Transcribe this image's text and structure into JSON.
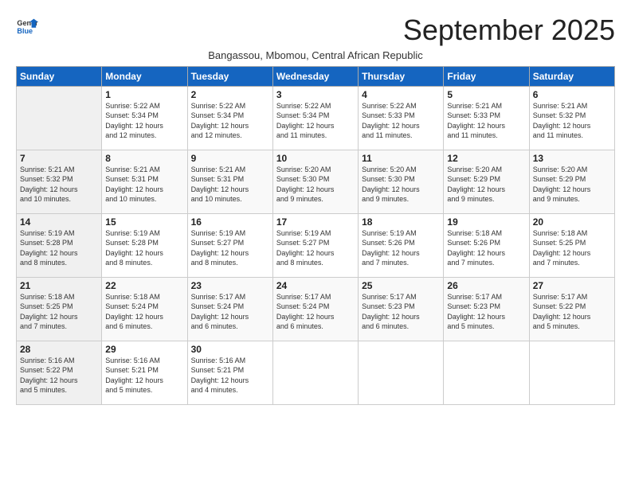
{
  "logo": {
    "line1": "General",
    "line2": "Blue"
  },
  "title": "September 2025",
  "subtitle": "Bangassou, Mbomou, Central African Republic",
  "days_header": [
    "Sunday",
    "Monday",
    "Tuesday",
    "Wednesday",
    "Thursday",
    "Friday",
    "Saturday"
  ],
  "weeks": [
    [
      {
        "day": "",
        "info": ""
      },
      {
        "day": "1",
        "info": "Sunrise: 5:22 AM\nSunset: 5:34 PM\nDaylight: 12 hours\nand 12 minutes."
      },
      {
        "day": "2",
        "info": "Sunrise: 5:22 AM\nSunset: 5:34 PM\nDaylight: 12 hours\nand 12 minutes."
      },
      {
        "day": "3",
        "info": "Sunrise: 5:22 AM\nSunset: 5:34 PM\nDaylight: 12 hours\nand 11 minutes."
      },
      {
        "day": "4",
        "info": "Sunrise: 5:22 AM\nSunset: 5:33 PM\nDaylight: 12 hours\nand 11 minutes."
      },
      {
        "day": "5",
        "info": "Sunrise: 5:21 AM\nSunset: 5:33 PM\nDaylight: 12 hours\nand 11 minutes."
      },
      {
        "day": "6",
        "info": "Sunrise: 5:21 AM\nSunset: 5:32 PM\nDaylight: 12 hours\nand 11 minutes."
      }
    ],
    [
      {
        "day": "7",
        "info": "Sunrise: 5:21 AM\nSunset: 5:32 PM\nDaylight: 12 hours\nand 10 minutes."
      },
      {
        "day": "8",
        "info": "Sunrise: 5:21 AM\nSunset: 5:31 PM\nDaylight: 12 hours\nand 10 minutes."
      },
      {
        "day": "9",
        "info": "Sunrise: 5:21 AM\nSunset: 5:31 PM\nDaylight: 12 hours\nand 10 minutes."
      },
      {
        "day": "10",
        "info": "Sunrise: 5:20 AM\nSunset: 5:30 PM\nDaylight: 12 hours\nand 9 minutes."
      },
      {
        "day": "11",
        "info": "Sunrise: 5:20 AM\nSunset: 5:30 PM\nDaylight: 12 hours\nand 9 minutes."
      },
      {
        "day": "12",
        "info": "Sunrise: 5:20 AM\nSunset: 5:29 PM\nDaylight: 12 hours\nand 9 minutes."
      },
      {
        "day": "13",
        "info": "Sunrise: 5:20 AM\nSunset: 5:29 PM\nDaylight: 12 hours\nand 9 minutes."
      }
    ],
    [
      {
        "day": "14",
        "info": "Sunrise: 5:19 AM\nSunset: 5:28 PM\nDaylight: 12 hours\nand 8 minutes."
      },
      {
        "day": "15",
        "info": "Sunrise: 5:19 AM\nSunset: 5:28 PM\nDaylight: 12 hours\nand 8 minutes."
      },
      {
        "day": "16",
        "info": "Sunrise: 5:19 AM\nSunset: 5:27 PM\nDaylight: 12 hours\nand 8 minutes."
      },
      {
        "day": "17",
        "info": "Sunrise: 5:19 AM\nSunset: 5:27 PM\nDaylight: 12 hours\nand 8 minutes."
      },
      {
        "day": "18",
        "info": "Sunrise: 5:19 AM\nSunset: 5:26 PM\nDaylight: 12 hours\nand 7 minutes."
      },
      {
        "day": "19",
        "info": "Sunrise: 5:18 AM\nSunset: 5:26 PM\nDaylight: 12 hours\nand 7 minutes."
      },
      {
        "day": "20",
        "info": "Sunrise: 5:18 AM\nSunset: 5:25 PM\nDaylight: 12 hours\nand 7 minutes."
      }
    ],
    [
      {
        "day": "21",
        "info": "Sunrise: 5:18 AM\nSunset: 5:25 PM\nDaylight: 12 hours\nand 7 minutes."
      },
      {
        "day": "22",
        "info": "Sunrise: 5:18 AM\nSunset: 5:24 PM\nDaylight: 12 hours\nand 6 minutes."
      },
      {
        "day": "23",
        "info": "Sunrise: 5:17 AM\nSunset: 5:24 PM\nDaylight: 12 hours\nand 6 minutes."
      },
      {
        "day": "24",
        "info": "Sunrise: 5:17 AM\nSunset: 5:24 PM\nDaylight: 12 hours\nand 6 minutes."
      },
      {
        "day": "25",
        "info": "Sunrise: 5:17 AM\nSunset: 5:23 PM\nDaylight: 12 hours\nand 6 minutes."
      },
      {
        "day": "26",
        "info": "Sunrise: 5:17 AM\nSunset: 5:23 PM\nDaylight: 12 hours\nand 5 minutes."
      },
      {
        "day": "27",
        "info": "Sunrise: 5:17 AM\nSunset: 5:22 PM\nDaylight: 12 hours\nand 5 minutes."
      }
    ],
    [
      {
        "day": "28",
        "info": "Sunrise: 5:16 AM\nSunset: 5:22 PM\nDaylight: 12 hours\nand 5 minutes."
      },
      {
        "day": "29",
        "info": "Sunrise: 5:16 AM\nSunset: 5:21 PM\nDaylight: 12 hours\nand 5 minutes."
      },
      {
        "day": "30",
        "info": "Sunrise: 5:16 AM\nSunset: 5:21 PM\nDaylight: 12 hours\nand 4 minutes."
      },
      {
        "day": "",
        "info": ""
      },
      {
        "day": "",
        "info": ""
      },
      {
        "day": "",
        "info": ""
      },
      {
        "day": "",
        "info": ""
      }
    ]
  ]
}
